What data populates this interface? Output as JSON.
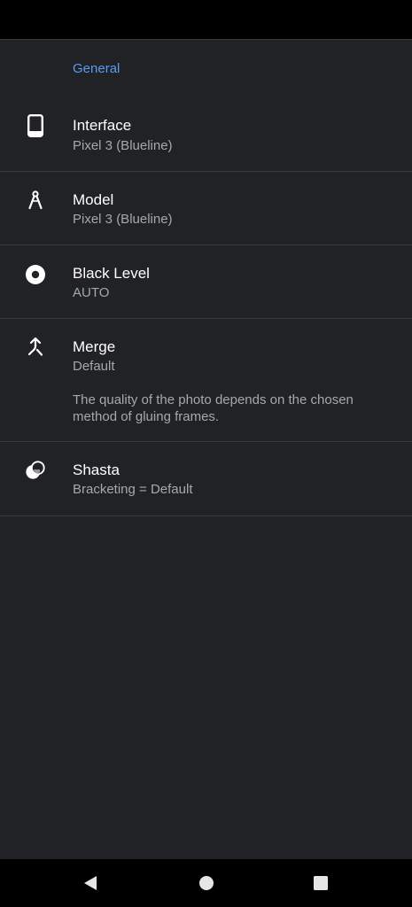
{
  "settings": {
    "section_title": "General",
    "items": [
      {
        "icon": "smartphone-icon",
        "title": "Interface",
        "summary": "Pixel 3 (Blueline)"
      },
      {
        "icon": "compass-drawing-icon",
        "title": "Model",
        "summary": "Pixel 3 (Blueline)"
      },
      {
        "icon": "exposure-circle-icon",
        "title": "Black Level",
        "summary": "AUTO"
      },
      {
        "icon": "merge-arrow-icon",
        "title": "Merge",
        "summary": "Default",
        "description": "The quality of the photo depends on the chosen method of gluing frames."
      },
      {
        "icon": "overlapping-circles-icon",
        "title": "Shasta",
        "summary": "Bracketing = Default"
      }
    ]
  },
  "navigation": {
    "buttons": [
      "back-icon",
      "home-icon",
      "recents-icon"
    ]
  },
  "colors": {
    "background": "#212226",
    "accent": "#5b9bf0",
    "divider": "#3a3b3f"
  }
}
